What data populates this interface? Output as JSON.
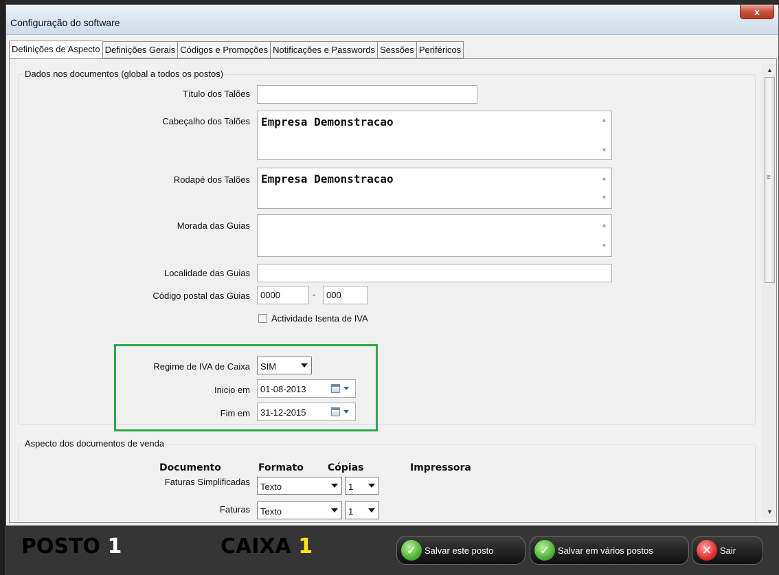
{
  "window": {
    "title": "Configuração do software",
    "close_glyph": "x"
  },
  "tabs": [
    {
      "label": "Definições de Aspecto",
      "active": true
    },
    {
      "label": "Definições Gerais",
      "active": false
    },
    {
      "label": "Códigos e Promoções",
      "active": false
    },
    {
      "label": "Notificações e Passwords",
      "active": false
    },
    {
      "label": "Sessões",
      "active": false
    },
    {
      "label": "Periféricos",
      "active": false
    }
  ],
  "documents_group": {
    "legend": "Dados nos documentos (global a todos os postos)",
    "titulo_label": "Título dos Talões",
    "titulo_value": "",
    "cabecalho_label": "Cabeçalho dos Talões",
    "cabecalho_value": "Empresa Demonstracao",
    "rodape_label": "Rodapé dos Talões",
    "rodape_value": "Empresa Demonstracao",
    "morada_label": "Morada das Guias",
    "morada_value": "",
    "localidade_label": "Localidade das Guias",
    "localidade_value": "",
    "codigo_postal_label": "Código postal das Guias",
    "codigo_postal_part1": "0000",
    "codigo_postal_sep": "-",
    "codigo_postal_part2": "000",
    "isento_label": "Actividade Isenta de IVA",
    "isento_checked": false,
    "regime_label": "Regime de IVA de Caixa",
    "regime_value": "SIM",
    "inicio_label": "Inicio em",
    "inicio_value": "01-08-2013",
    "fim_label": "Fim em",
    "fim_value": "31-12-2015"
  },
  "sales_group": {
    "legend": "Aspecto dos documentos de venda",
    "headers": {
      "documento": "Documento",
      "formato": "Formato",
      "copias": "Cópias",
      "impressora": "Impressora"
    },
    "rows": [
      {
        "documento": "Faturas Simplificadas",
        "formato": "Texto",
        "copias": "1"
      },
      {
        "documento": "Faturas",
        "formato": "Texto",
        "copias": "1"
      }
    ]
  },
  "scrollbar": {
    "up_glyph": "▲",
    "down_glyph": "▼",
    "grip_glyph": "≡"
  },
  "textarea_scroll": {
    "up_glyph": "▲",
    "down_glyph": "▼"
  },
  "bottom": {
    "posto_label": "POSTO",
    "posto_num": "1",
    "caixa_label": "CAIXA",
    "caixa_num": "1",
    "save_this_label": "Salvar este posto",
    "save_many_label": "Salvar em vários postos",
    "exit_label": "Sair",
    "ok_glyph": "✓",
    "exit_glyph": "✕"
  },
  "colors": {
    "highlight": "#2ca84a",
    "caixa_num": "#ffe600"
  }
}
